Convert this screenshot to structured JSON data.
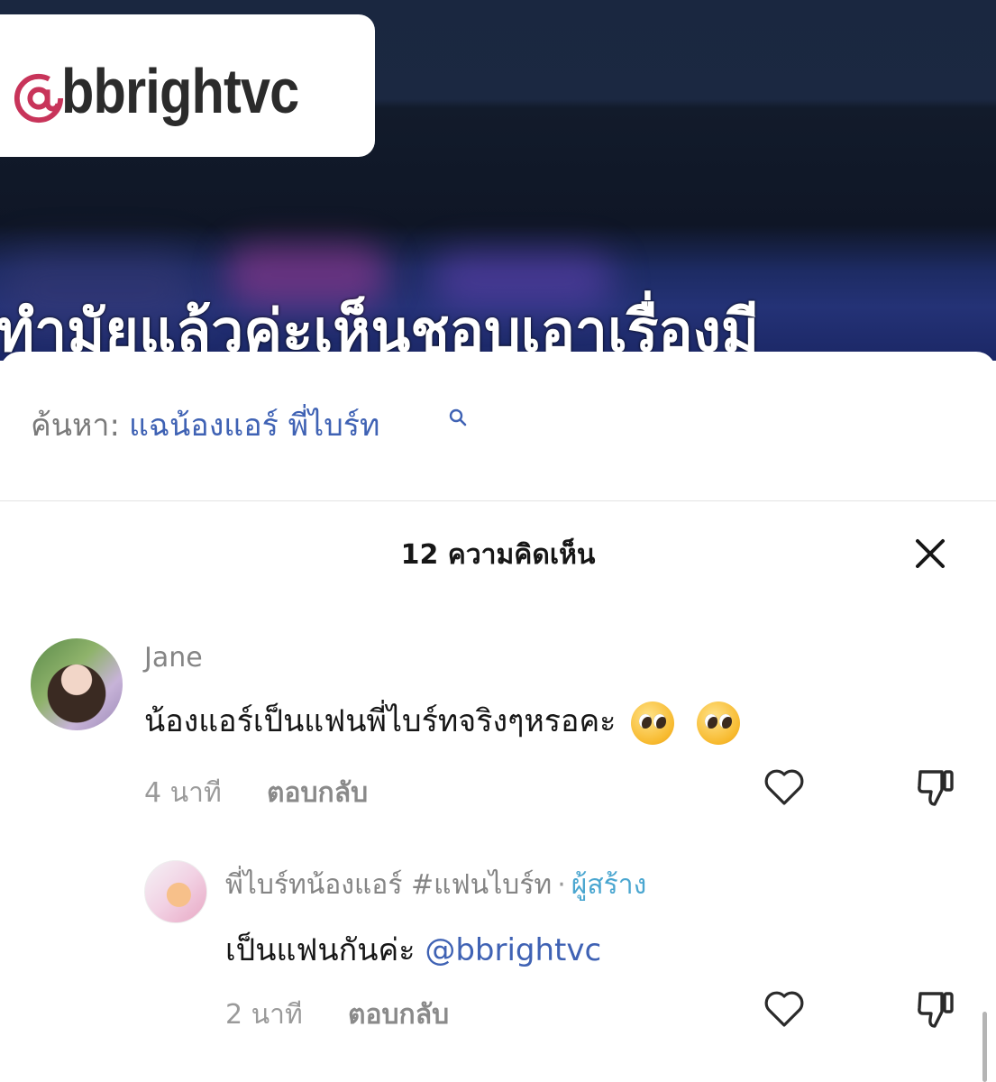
{
  "video": {
    "handle": "bbright​vc",
    "caption": "ทำมัยแล้วค่ะเห็นชอบเอาเรื่องมี"
  },
  "search": {
    "label": "ค้นหา:",
    "query": "แฉน้องแอร์ พี่ไบร์ท"
  },
  "comments_header": {
    "title": "12 ความคิดเห็น"
  },
  "comments": [
    {
      "author": "Jane",
      "text": "น้องแอร์เป็นแฟนพี่ไบร์ทจริงๆหรอคะ",
      "time": "4 นาที",
      "reply_label": "ตอบกลับ"
    },
    {
      "author": "พี่ไบร์ทน้องแอร์ #แฟนไบร์ท",
      "separator": "·",
      "author_badge": "ผู้สร้าง",
      "text": "เป็นแฟนกันค่ะ",
      "mention": "@bbrightvc",
      "time": "2 นาที",
      "reply_label": "ตอบกลับ"
    }
  ],
  "colors": {
    "link_blue": "#3f62b4",
    "creator_badge": "#4aa6d0",
    "handle_pink": "#c8345a"
  }
}
